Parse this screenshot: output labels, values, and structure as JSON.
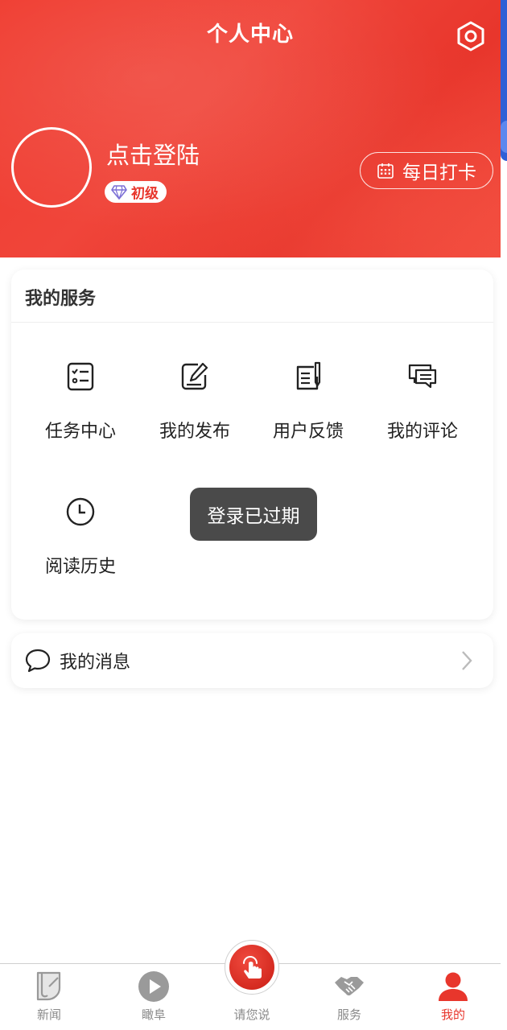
{
  "header": {
    "title": "个人中心",
    "login_text": "点击登陆",
    "level": "初级",
    "checkin_label": "每日打卡",
    "colors": {
      "primary": "#e8362c",
      "accent_strip": "#2f5fd6"
    }
  },
  "services": {
    "title": "我的服务",
    "items": [
      {
        "label": "任务中心",
        "icon": "task-list-icon"
      },
      {
        "label": "我的发布",
        "icon": "edit-icon"
      },
      {
        "label": "用户反馈",
        "icon": "feedback-doc-icon"
      },
      {
        "label": "我的评论",
        "icon": "comments-icon"
      },
      {
        "label": "阅读历史",
        "icon": "clock-icon"
      }
    ]
  },
  "toast": {
    "message": "登录已过期"
  },
  "messages": {
    "label": "我的消息"
  },
  "tabbar": {
    "items": [
      {
        "label": "新闻",
        "icon": "news-icon"
      },
      {
        "label": "瞰阜",
        "icon": "play-icon"
      },
      {
        "label": "请您说",
        "icon": "tap-hand-icon"
      },
      {
        "label": "服务",
        "icon": "handshake-icon"
      },
      {
        "label": "我的",
        "icon": "user-icon",
        "active": true
      }
    ]
  }
}
